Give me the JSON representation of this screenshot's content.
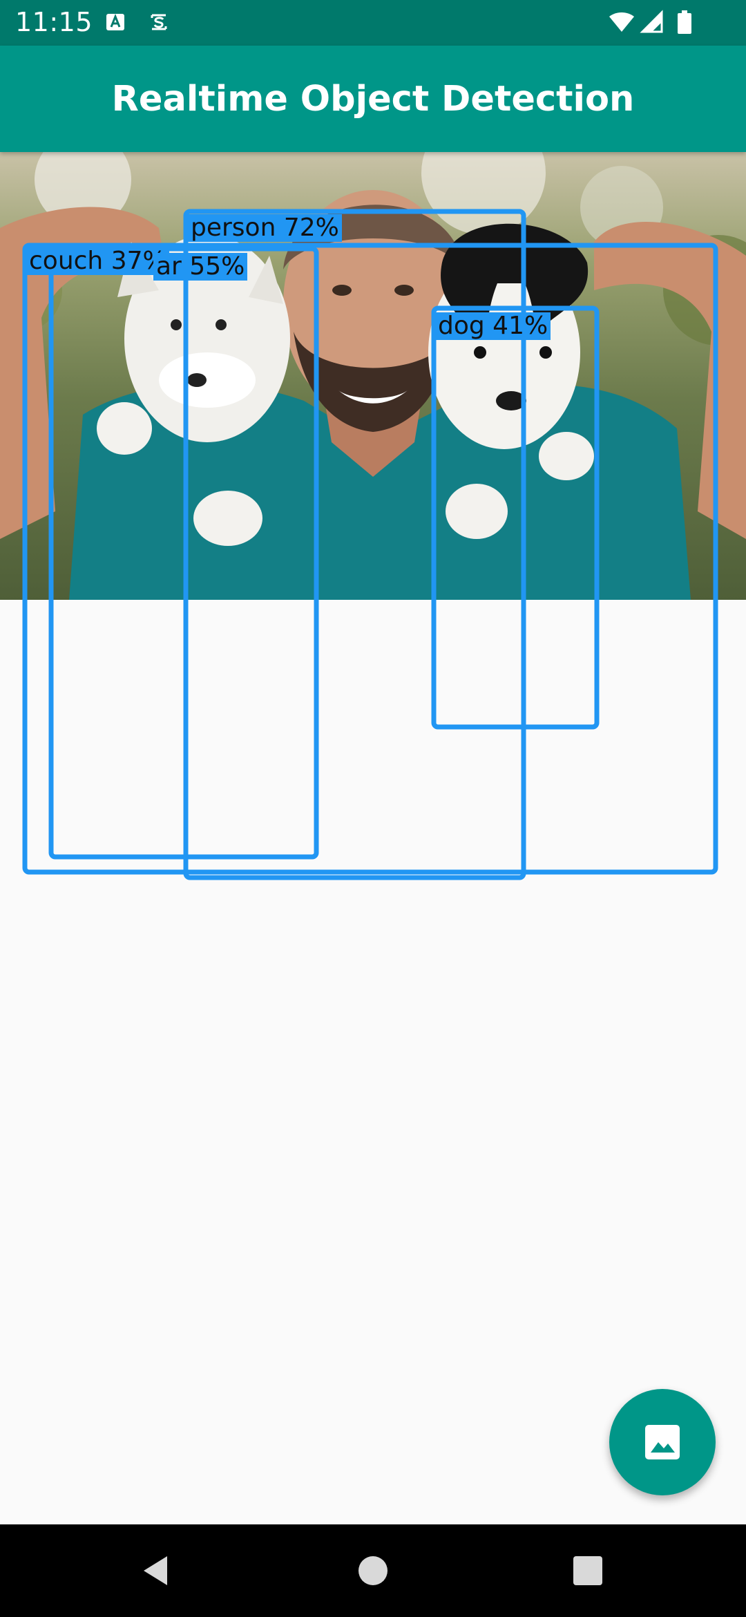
{
  "status_bar": {
    "time": "11:15",
    "icons": [
      "text-a-icon",
      "screen-capture-icon",
      "wifi-icon",
      "signal-icon",
      "battery-icon"
    ]
  },
  "app_bar": {
    "title": "Realtime Object Detection"
  },
  "detections": [
    {
      "label": "person 72%"
    },
    {
      "label": "couch 37%"
    },
    {
      "label": "ar 55%"
    },
    {
      "label": "dog 41%"
    }
  ],
  "fab": {
    "icon": "image-icon"
  },
  "nav": {
    "icons": [
      "back-icon",
      "home-icon",
      "recents-icon"
    ]
  },
  "colors": {
    "primary": "#009688",
    "primary_dark": "#00796b",
    "detection_box": "#2196f3",
    "background": "#fafafa"
  }
}
